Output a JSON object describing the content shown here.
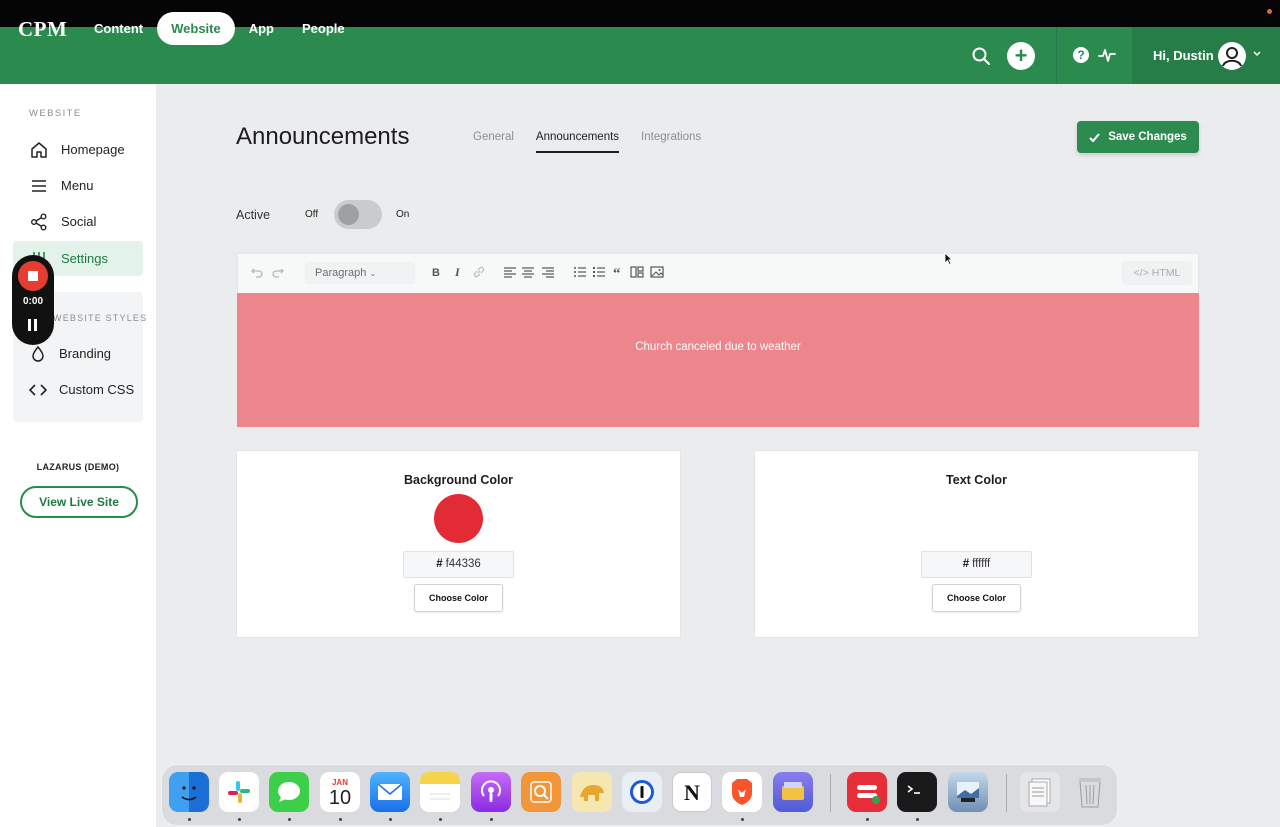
{
  "nav": {
    "logo": "CPM",
    "links": [
      "Content",
      "Website",
      "App",
      "People"
    ],
    "active_link": "Website",
    "greeting": "Hi, Dustin",
    "icons": [
      "search-icon",
      "plus-icon",
      "help-icon",
      "activity-icon",
      "user-avatar-icon",
      "chevron-down-icon"
    ]
  },
  "sidebar": {
    "section_title": "WEBSITE",
    "items": [
      {
        "label": "Homepage",
        "icon": "home-icon"
      },
      {
        "label": "Menu",
        "icon": "menu-icon"
      },
      {
        "label": "Social",
        "icon": "share-icon"
      },
      {
        "label": "Settings",
        "icon": "settings-icon",
        "active": true
      }
    ],
    "styles_title": "WEBSITE STYLES",
    "style_items": [
      {
        "label": "Branding",
        "icon": "drop-icon"
      },
      {
        "label": "Custom CSS",
        "icon": "code-icon"
      }
    ],
    "site_name": "LAZARUS (DEMO)",
    "view_live_label": "View Live Site"
  },
  "recorder": {
    "time": "0:00"
  },
  "main": {
    "title": "Announcements",
    "tabs": [
      "General",
      "Announcements",
      "Integrations"
    ],
    "active_tab": "Announcements",
    "save_label": "Save Changes",
    "active_label": "Active",
    "toggle_off": "Off",
    "toggle_on": "On",
    "toggle_state": false,
    "editor": {
      "paragraph_label": "Paragraph",
      "html_label": "HTML",
      "announcement_text": "Church canceled due to weather",
      "banner_color": "#ec858c"
    },
    "background_color": {
      "title": "Background Color",
      "hex": "f44336",
      "choose_label": "Choose Color"
    },
    "text_color": {
      "title": "Text Color",
      "hex": "ffffff",
      "choose_label": "Choose Color"
    },
    "hash": "#"
  },
  "colors": {
    "brand_green": "#2b8a4e",
    "swatch_red": "#e32b35"
  },
  "dock": {
    "calendar_month": "JAN",
    "calendar_day": "10"
  }
}
